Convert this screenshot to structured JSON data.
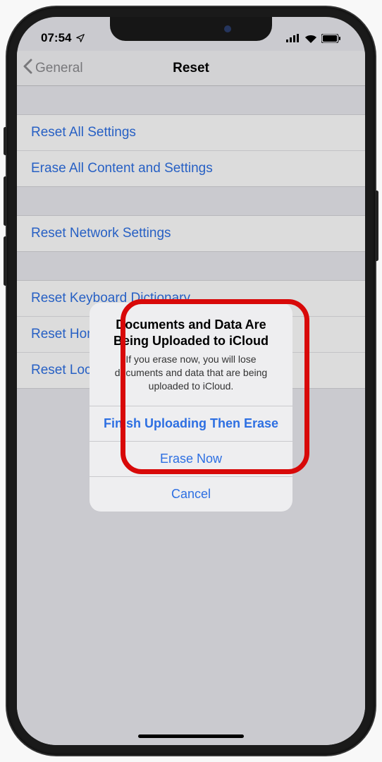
{
  "status": {
    "time": "07:54"
  },
  "nav": {
    "back": "General",
    "title": "Reset"
  },
  "groups": [
    {
      "rows": [
        "Reset All Settings",
        "Erase All Content and Settings"
      ]
    },
    {
      "rows": [
        "Reset Network Settings"
      ]
    },
    {
      "rows": [
        "Reset Keyboard Dictionary",
        "Reset Home Screen Layout",
        "Reset Location & Privacy"
      ]
    }
  ],
  "alert": {
    "title": "Documents and Data Are Being Uploaded to iCloud",
    "message": "If you erase now, you will lose documents and data that are being uploaded to iCloud.",
    "primary": "Finish Uploading Then Erase",
    "secondary": "Erase Now",
    "cancel": "Cancel"
  }
}
